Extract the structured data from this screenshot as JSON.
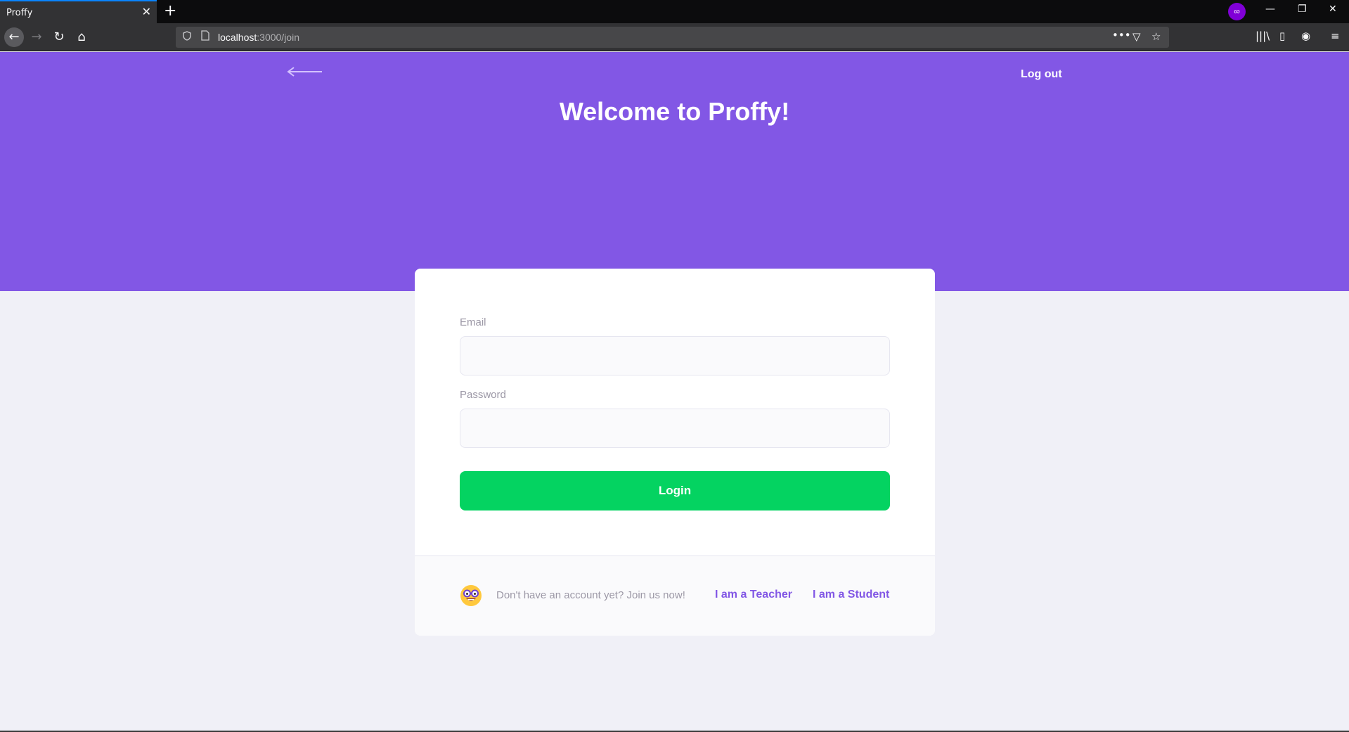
{
  "browser": {
    "tab_title": "Proffy",
    "tab_close": "✕",
    "new_tab": "+",
    "private_badge": "∞",
    "url_host": "localhost",
    "url_path": ":3000/join",
    "nav": {
      "back": "←",
      "forward": "→",
      "reload": "↻",
      "home": "⌂"
    },
    "url_actions": {
      "more": "•••",
      "pocket": "▽",
      "bookmark": "☆"
    },
    "tools": {
      "library": "|||\\",
      "sidebar": "▯",
      "account": "◉",
      "menu": "≡"
    },
    "window": {
      "minimize": "—",
      "restore": "❐",
      "close": "✕"
    }
  },
  "header": {
    "logout_label": "Log out",
    "title": "Welcome to Proffy!"
  },
  "form": {
    "email_label": "Email",
    "email_value": "",
    "password_label": "Password",
    "password_value": "",
    "login_label": "Login"
  },
  "footer": {
    "join_text": "Don't have an account yet? Join us now!",
    "teacher_link": "I am a Teacher",
    "student_link": "I am a Student"
  },
  "colors": {
    "primary": "#8257E5",
    "background": "#F0F0F7",
    "success": "#04D361",
    "text_muted": "#9C98A6"
  },
  "icons": [
    "back-arrow-icon",
    "smiling-face-with-glasses-icon"
  ]
}
